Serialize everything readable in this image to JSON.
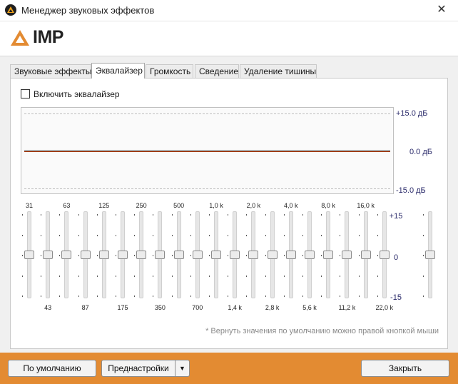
{
  "window": {
    "title": "Менеджер звуковых эффектов",
    "close_glyph": "✕",
    "logo_text": "IMP",
    "brand_color": "#e38b32"
  },
  "tabs": [
    {
      "label": "Звуковые эффекты",
      "active": false
    },
    {
      "label": "Эквалайзер",
      "active": true
    },
    {
      "label": "Громкость",
      "active": false
    },
    {
      "label": "Сведение",
      "active": false
    },
    {
      "label": "Удаление тишины",
      "active": false
    }
  ],
  "equalizer": {
    "enable_label": "Включить эквалайзер",
    "enabled": false,
    "graph_labels": {
      "top": "+15.0 дБ",
      "mid": "0.0 дБ",
      "bottom": "-15.0 дБ"
    },
    "freq_top": [
      "31",
      "63",
      "125",
      "250",
      "500",
      "1,0 k",
      "2,0 k",
      "4,0 k",
      "8,0 k",
      "16,0 k"
    ],
    "freq_bottom": [
      "43",
      "87",
      "175",
      "350",
      "700",
      "1,4 k",
      "2,8 k",
      "5,6 k",
      "11,2 k",
      "22,0 k"
    ],
    "band_values_db": [
      0,
      0,
      0,
      0,
      0,
      0,
      0,
      0,
      0,
      0,
      0,
      0,
      0,
      0,
      0,
      0,
      0,
      0,
      0,
      0
    ],
    "preamp_db": 0,
    "scale": {
      "top": "+15",
      "mid": "0",
      "bottom": "-15"
    },
    "hint": "* Вернуть значения по умолчанию можно правой кнопкой мыши"
  },
  "buttons": {
    "default": "По умолчанию",
    "presets": "Преднастройки",
    "presets_arrow": "▼",
    "close": "Закрыть"
  }
}
